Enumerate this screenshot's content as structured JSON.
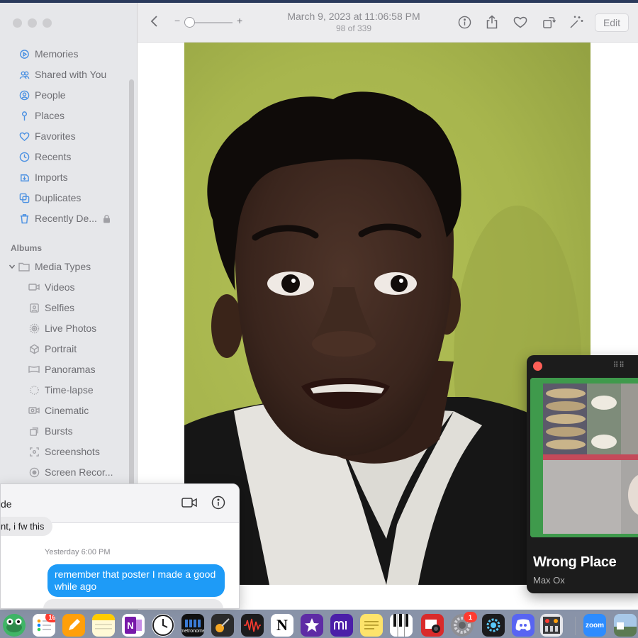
{
  "sidebar": {
    "library_items": [
      {
        "label": "Memories",
        "icon": "memories-icon"
      },
      {
        "label": "Shared with You",
        "icon": "shared-icon"
      },
      {
        "label": "People",
        "icon": "people-icon"
      },
      {
        "label": "Places",
        "icon": "places-icon"
      },
      {
        "label": "Favorites",
        "icon": "heart-icon"
      },
      {
        "label": "Recents",
        "icon": "clock-icon"
      },
      {
        "label": "Imports",
        "icon": "imports-icon"
      },
      {
        "label": "Duplicates",
        "icon": "duplicates-icon"
      },
      {
        "label": "Recently De...",
        "icon": "trash-icon"
      }
    ],
    "albums_header": "Albums",
    "media_types_label": "Media Types",
    "media_types": [
      {
        "label": "Videos",
        "icon": "video-icon"
      },
      {
        "label": "Selfies",
        "icon": "selfie-icon"
      },
      {
        "label": "Live Photos",
        "icon": "live-photo-icon"
      },
      {
        "label": "Portrait",
        "icon": "portrait-icon"
      },
      {
        "label": "Panoramas",
        "icon": "panorama-icon"
      },
      {
        "label": "Time-lapse",
        "icon": "timelapse-icon"
      },
      {
        "label": "Cinematic",
        "icon": "cinematic-icon"
      },
      {
        "label": "Bursts",
        "icon": "bursts-icon"
      },
      {
        "label": "Screenshots",
        "icon": "screenshot-icon"
      },
      {
        "label": "Screen Recor...",
        "icon": "screen-record-icon"
      }
    ]
  },
  "toolbar": {
    "date": "March 9, 2023 at 11:06:58 PM",
    "count": "98 of 339",
    "zoom_minus": "−",
    "zoom_plus": "+",
    "edit_label": "Edit"
  },
  "messages": {
    "contact": "de",
    "received_text": "nt, i fw this",
    "timestamp": "Yesterday 6:00 PM",
    "sent_text": "remember that poster I made a good while ago"
  },
  "player": {
    "title": "Wrong Place",
    "artist": "Max Ox",
    "grip": "⠿⠿"
  },
  "dock": {
    "reminders_badge": "16",
    "settings_badge": "1",
    "notion_letter": "N",
    "zoom_label": "zoom",
    "metronome_label": "metronome"
  },
  "colors": {
    "accent": "#4a90e2",
    "bubble_blue": "#1e9bf7",
    "photo_wall": "#a7b54d",
    "spotify_art_green": "#3f9a4c"
  }
}
